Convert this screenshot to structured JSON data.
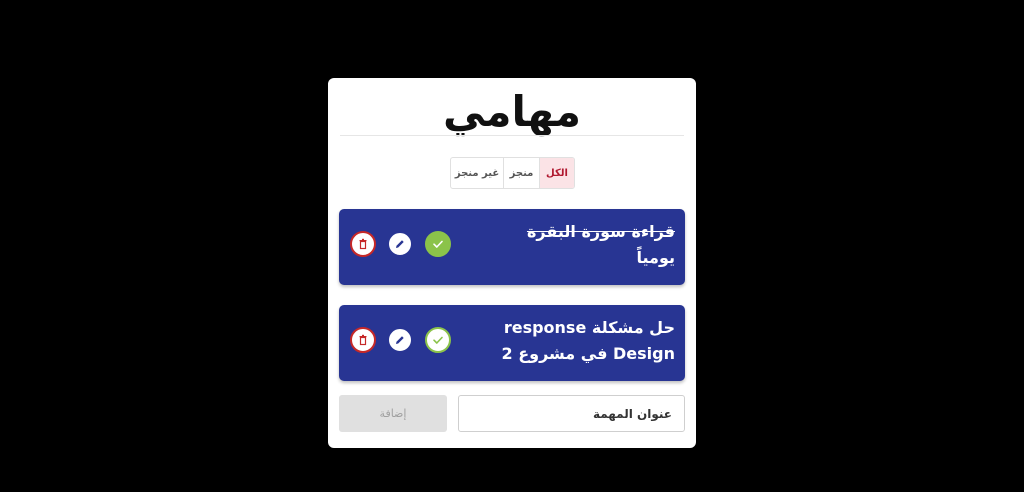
{
  "header": {
    "title": "مهامي"
  },
  "filters": {
    "all_label": "الكل",
    "done_label": "منجز",
    "undone_label": "غير منجز",
    "active": "all"
  },
  "tasks": [
    {
      "title": "قراءة سورة البقرة",
      "details": "يومياً",
      "completed": true
    },
    {
      "title": "حل مشكلة response",
      "details": "Design في مشروع 2",
      "completed": false
    }
  ],
  "form": {
    "input_placeholder": "عنوان المهمة",
    "add_label": "إضافة"
  },
  "colors": {
    "task_bg": "#283593",
    "delete": "#c62828",
    "check": "#8bc34a",
    "active_filter_bg": "#fbe3e6",
    "active_filter_text": "#b0182f"
  }
}
